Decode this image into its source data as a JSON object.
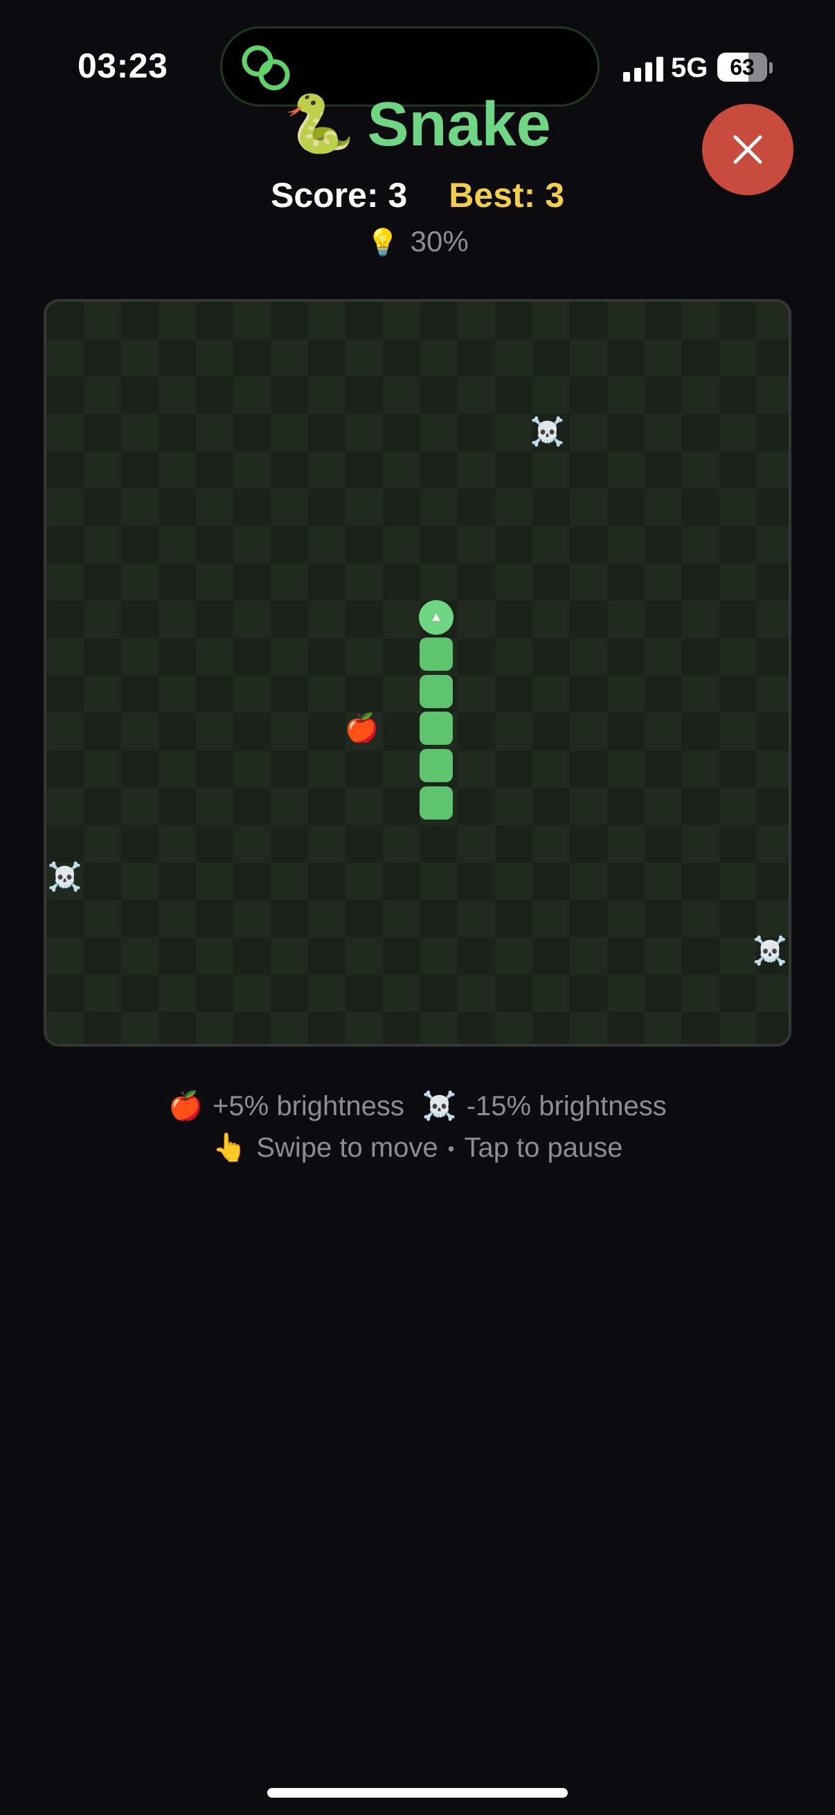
{
  "status_bar": {
    "time": "03:23",
    "network": "5G",
    "battery_level": "63",
    "signal_bars": 4
  },
  "header": {
    "title": "Snake",
    "title_icon": "snake-icon",
    "title_emoji": "🐍",
    "score_text": "Score: 3",
    "best_text": "Best: 3",
    "brightness_icon": "lightbulb-icon",
    "brightness_emoji": "💡",
    "brightness_text": "30%",
    "close_icon": "close-icon"
  },
  "board": {
    "grid_size": 20,
    "snake": [
      {
        "col": 10,
        "row": 8,
        "head": true,
        "direction": "up"
      },
      {
        "col": 10,
        "row": 9
      },
      {
        "col": 10,
        "row": 10
      },
      {
        "col": 10,
        "row": 11
      },
      {
        "col": 10,
        "row": 12
      },
      {
        "col": 10,
        "row": 13
      }
    ],
    "food": [
      {
        "type": "apple",
        "emoji": "🍎",
        "col": 8,
        "row": 11
      }
    ],
    "hazards": [
      {
        "type": "skull",
        "emoji": "☠️",
        "col": 13,
        "row": 3
      },
      {
        "type": "skull",
        "emoji": "☠️",
        "col": 0,
        "row": 15
      },
      {
        "type": "skull",
        "emoji": "☠️",
        "col": 19,
        "row": 17
      }
    ]
  },
  "legend": {
    "apple_emoji": "🍎",
    "apple_text": "+5% brightness",
    "skull_emoji": "☠️",
    "skull_text": "-15% brightness",
    "swipe_emoji": "👆",
    "swipe_text": "Swipe to move",
    "separator": "•",
    "tap_text": "Tap to pause"
  },
  "colors": {
    "accent": "#6fd684",
    "best": "#f2cf47",
    "close_button": "#c94b3e",
    "snake_body": "#5ec46d",
    "board_dark": "#1a2219",
    "board_light": "#202a1e",
    "background": "#0b0b10"
  }
}
